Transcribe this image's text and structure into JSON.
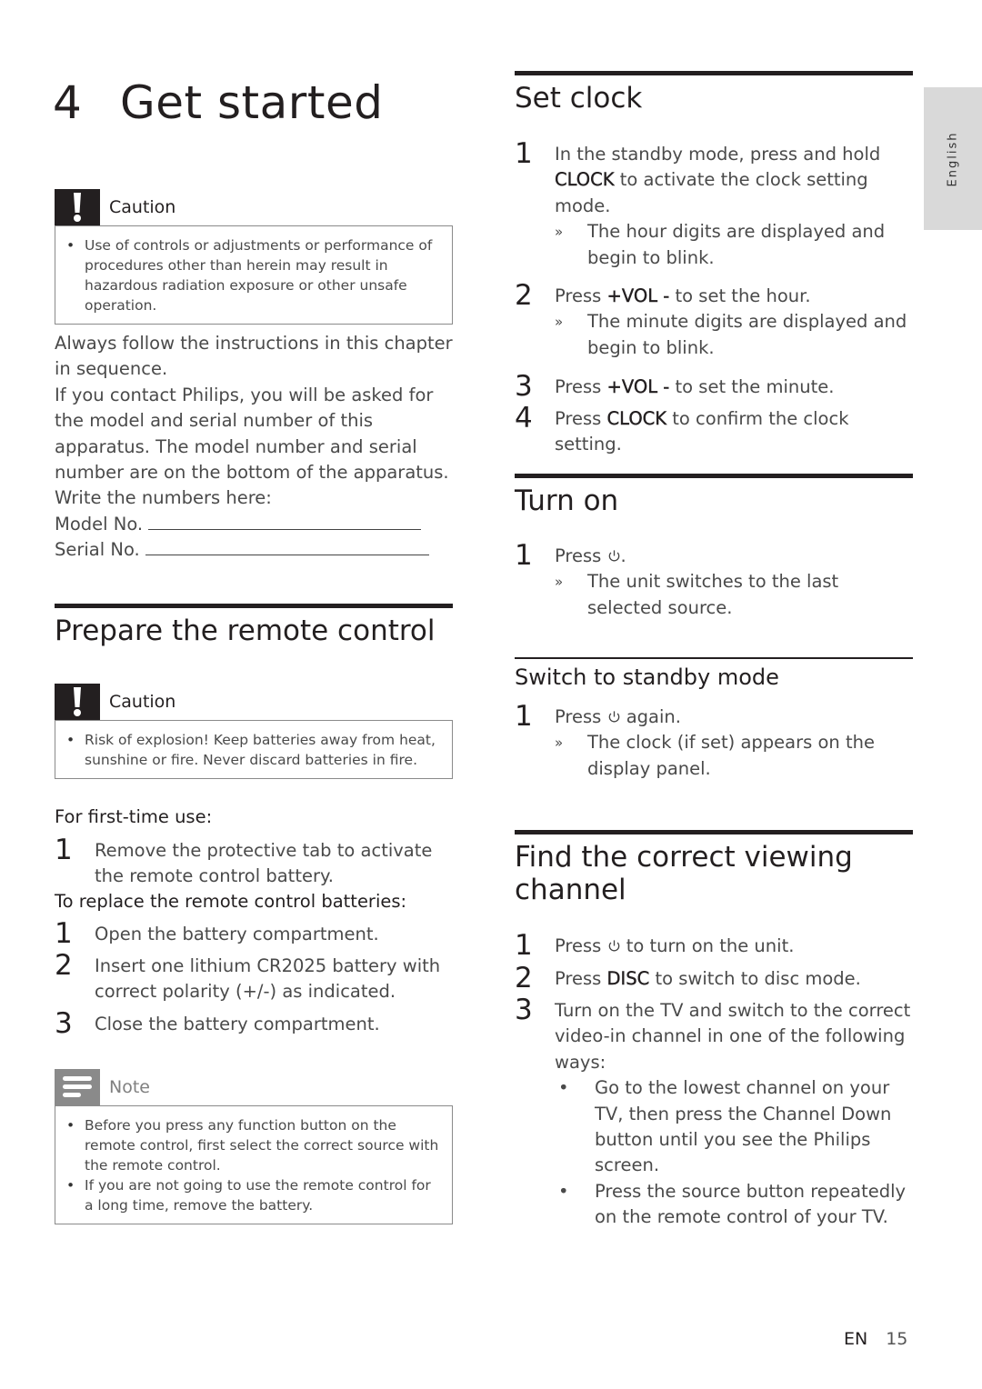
{
  "chapter": {
    "number": "4",
    "title": "Get started"
  },
  "side_tab": {
    "label": "English"
  },
  "caution1": {
    "label": "Caution",
    "icon": "exclamation-icon",
    "items": [
      "Use of controls or adjustments or performance of procedures other than herein may result in hazardous radiation exposure or other unsafe operation."
    ]
  },
  "intro": {
    "lines": [
      "Always follow the instructions in this chapter in sequence.",
      "If you contact Philips, you will be asked for the model and serial number of this apparatus. The model number and serial number are on the bottom of the apparatus. Write the numbers here:"
    ],
    "model_label": "Model No.",
    "serial_label": "Serial No."
  },
  "remote": {
    "title": "Prepare the remote control",
    "caution": {
      "label": "Caution",
      "icon": "exclamation-icon",
      "items": [
        "Risk of explosion! Keep batteries away from heat, sunshine or fire. Never discard batteries in fire."
      ]
    },
    "first_use_label": "For first-time use:",
    "first_use_steps": [
      {
        "n": "1",
        "text": "Remove the protective tab to activate the remote control battery."
      }
    ],
    "replace_label": "To replace the remote control batteries:",
    "replace_steps": [
      {
        "n": "1",
        "text": "Open the battery compartment."
      },
      {
        "n": "2",
        "text": "Insert one lithium CR2025 battery with correct polarity (+/-) as indicated."
      },
      {
        "n": "3",
        "text": "Close the battery compartment."
      }
    ],
    "note": {
      "label": "Note",
      "icon": "note-lines-icon",
      "items": [
        "Before you press any function button on the remote control, first select the correct source with the remote control.",
        "If you are not going to use the remote control for a long time, remove the battery."
      ]
    }
  },
  "set_clock": {
    "title": "Set clock",
    "steps": [
      {
        "n": "1",
        "pre": "In the standby mode, press and hold ",
        "key": "CLOCK",
        "post": " to activate the clock setting mode.",
        "result": "The hour digits are displayed and begin to blink."
      },
      {
        "n": "2",
        "pre": "Press ",
        "key": "+VOL -",
        "post": " to set the hour.",
        "result": "The minute digits are displayed and begin to blink."
      },
      {
        "n": "3",
        "pre": "Press ",
        "key": "+VOL -",
        "post": " to set the minute."
      },
      {
        "n": "4",
        "pre": "Press ",
        "key": "CLOCK",
        "post": " to confirm the clock setting."
      }
    ]
  },
  "turn_on": {
    "title": "Turn on",
    "steps": [
      {
        "n": "1",
        "pre": "Press ",
        "icon": "power-icon",
        "post": ".",
        "result": "The unit switches to the last selected source."
      }
    ]
  },
  "standby": {
    "title": "Switch to standby mode",
    "steps": [
      {
        "n": "1",
        "pre": "Press ",
        "icon": "power-icon",
        "post": " again.",
        "result": "The clock (if set) appears on the display panel."
      }
    ]
  },
  "channel": {
    "title": "Find the correct viewing channel",
    "steps": [
      {
        "n": "1",
        "pre": "Press ",
        "icon": "power-icon",
        "post": " to turn on the unit."
      },
      {
        "n": "2",
        "pre": "Press ",
        "key": "DISC",
        "post": " to switch to disc mode."
      },
      {
        "n": "3",
        "pre": "Turn on the TV and switch to the correct video-in channel in one of the following ways:",
        "bullets": [
          "Go to the lowest channel on your TV, then press the Channel Down button until you see the Philips screen.",
          "Press the source button repeatedly on the remote control of your TV."
        ]
      }
    ]
  },
  "footer": {
    "lang": "EN",
    "page": "15"
  },
  "result_mark": "»",
  "bullet_mark": "•"
}
